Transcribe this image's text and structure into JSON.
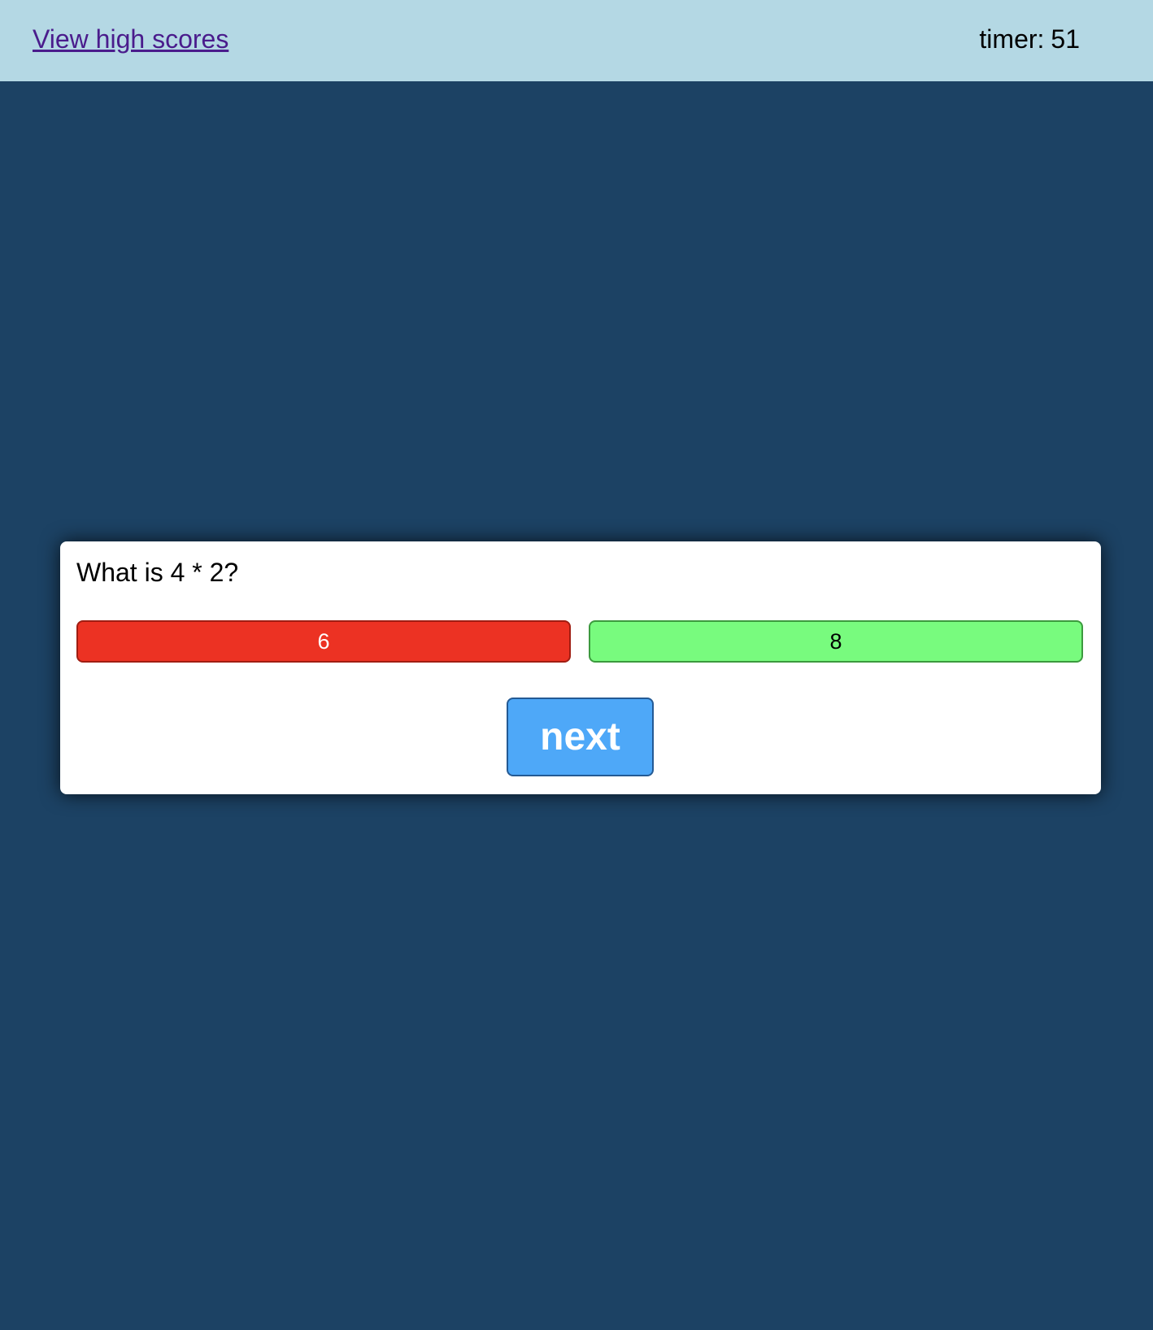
{
  "header": {
    "high_scores_link": "View high scores",
    "timer_label": "timer:",
    "timer_value": "51"
  },
  "quiz": {
    "question": "What is 4 * 2?",
    "answers": [
      {
        "label": "6",
        "state": "wrong",
        "color": "#ec3223"
      },
      {
        "label": "8",
        "state": "correct",
        "color": "#78fb7e"
      }
    ],
    "next_label": "next"
  },
  "colors": {
    "page_background": "#1c4264",
    "header_background": "#b4d8e4",
    "link": "#4a1c8c",
    "next_button": "#4ea8f8"
  }
}
